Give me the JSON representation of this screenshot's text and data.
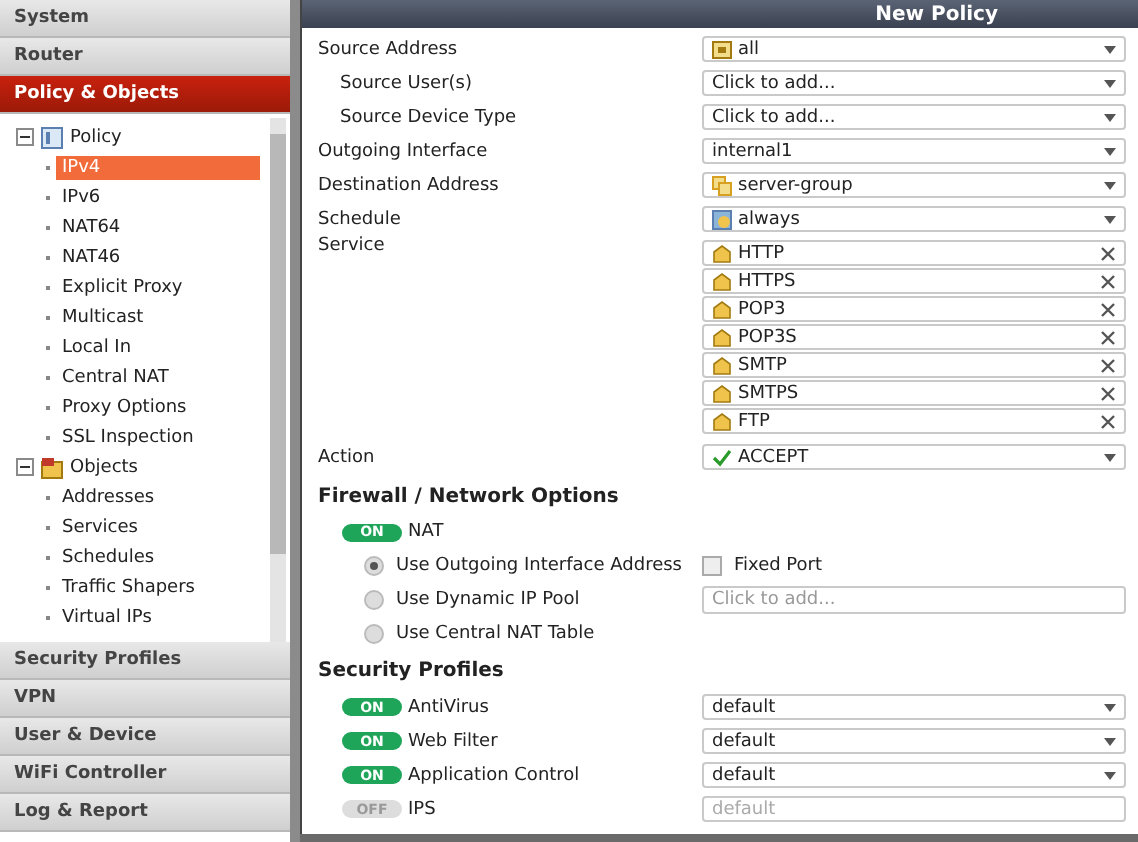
{
  "sidebar": {
    "menu": [
      {
        "label": "System",
        "selected": false
      },
      {
        "label": "Router",
        "selected": false
      },
      {
        "label": "Policy & Objects",
        "selected": true
      },
      {
        "label": "Security Profiles",
        "selected": false
      },
      {
        "label": "VPN",
        "selected": false
      },
      {
        "label": "User & Device",
        "selected": false
      },
      {
        "label": "WiFi Controller",
        "selected": false
      },
      {
        "label": "Log & Report",
        "selected": false
      }
    ],
    "tree": [
      {
        "label": "Policy",
        "kind": "policy",
        "expanded": true,
        "children": [
          {
            "label": "IPv4",
            "selected": true
          },
          {
            "label": "IPv6",
            "selected": false
          },
          {
            "label": "NAT64",
            "selected": false
          },
          {
            "label": "NAT46",
            "selected": false
          },
          {
            "label": "Explicit Proxy",
            "selected": false
          },
          {
            "label": "Multicast",
            "selected": false
          },
          {
            "label": "Local In",
            "selected": false
          },
          {
            "label": "Central NAT",
            "selected": false
          },
          {
            "label": "Proxy Options",
            "selected": false
          },
          {
            "label": "SSL Inspection",
            "selected": false
          }
        ]
      },
      {
        "label": "Objects",
        "kind": "objects",
        "expanded": true,
        "children": [
          {
            "label": "Addresses",
            "selected": false
          },
          {
            "label": "Services",
            "selected": false
          },
          {
            "label": "Schedules",
            "selected": false
          },
          {
            "label": "Traffic Shapers",
            "selected": false
          },
          {
            "label": "Virtual IPs",
            "selected": false
          }
        ]
      }
    ]
  },
  "panel": {
    "title": "New Policy",
    "fields": [
      {
        "label": "Source Address",
        "kind": "address",
        "value": "all",
        "children": [
          {
            "label": "Source User(s)",
            "value": "Click to add..."
          },
          {
            "label": "Source Device Type",
            "value": "Click to add..."
          }
        ]
      },
      {
        "label": "Outgoing Interface",
        "value": "internal1"
      },
      {
        "label": "Destination Address",
        "kind": "group",
        "value": "server-group"
      },
      {
        "label": "Schedule",
        "kind": "schedule",
        "value": "always"
      },
      {
        "label": "Service",
        "kind": "services",
        "values": [
          "HTTP",
          "HTTPS",
          "POP3",
          "POP3S",
          "SMTP",
          "SMTPS",
          "FTP"
        ]
      },
      {
        "label": "Action",
        "kind": "action",
        "value": "ACCEPT"
      }
    ],
    "firewall": {
      "title": "Firewall / Network Options",
      "nat": {
        "label": "NAT",
        "on": true,
        "toggle_text": "ON"
      },
      "options": [
        {
          "label": "Use Outgoing Interface Address",
          "selected": true,
          "extra": {
            "kind": "checkbox",
            "label": "Fixed Port",
            "checked": false
          }
        },
        {
          "label": "Use Dynamic IP Pool",
          "selected": false,
          "extra": {
            "kind": "field",
            "placeholder": "Click to add..."
          }
        },
        {
          "label": "Use Central NAT Table",
          "selected": false
        }
      ]
    },
    "security": {
      "title": "Security Profiles",
      "profiles": [
        {
          "label": "AntiVirus",
          "on": true,
          "toggle_text": "ON",
          "value": "default"
        },
        {
          "label": "Web Filter",
          "on": true,
          "toggle_text": "ON",
          "value": "default"
        },
        {
          "label": "Application Control",
          "on": true,
          "toggle_text": "ON",
          "value": "default"
        },
        {
          "label": "IPS",
          "on": false,
          "toggle_text": "OFF",
          "value": "default"
        }
      ]
    }
  }
}
